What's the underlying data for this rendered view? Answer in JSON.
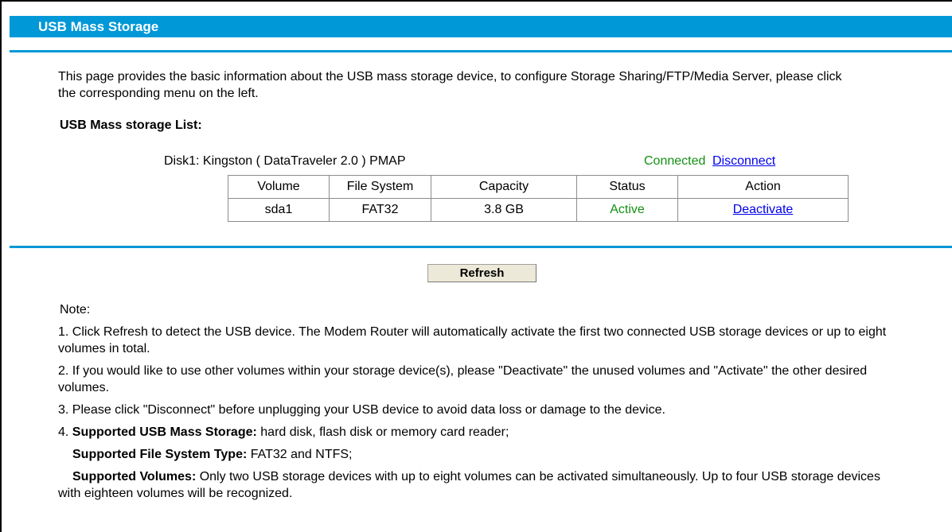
{
  "header": {
    "title": "USB Mass Storage"
  },
  "intro": {
    "text": "This page provides the basic information about the USB mass storage device, to configure Storage Sharing/FTP/Media Server, please click the corresponding menu on the left."
  },
  "storage_list": {
    "title": "USB Mass storage List:",
    "disk": {
      "label": "Disk1: Kingston ( DataTraveler 2.0 ) PMAP",
      "status": "Connected",
      "disconnect_label": "Disconnect"
    },
    "table": {
      "headers": [
        "Volume",
        "File System",
        "Capacity",
        "Status",
        "Action"
      ],
      "rows": [
        {
          "volume": "sda1",
          "file_system": "FAT32",
          "capacity": "3.8 GB",
          "status": "Active",
          "action": "Deactivate"
        }
      ]
    }
  },
  "refresh_label": "Refresh",
  "notes": {
    "label": "Note:",
    "items": [
      "1. Click Refresh to detect the USB device. The Modem Router will automatically activate the first two connected USB storage devices or up to eight volumes in total.",
      "2. If you would like to use other volumes within your storage device(s), please \"Deactivate\" the unused volumes and \"Activate\" the other desired volumes.",
      "3. Please click \"Disconnect\" before unplugging your USB device to avoid data loss or damage to the device."
    ],
    "supported": {
      "prefix": "4. ",
      "mass_storage_label": "Supported USB Mass Storage:",
      "mass_storage_value": " hard disk, flash disk or memory card reader;",
      "fs_label": "Supported File System Type:",
      "fs_value": " FAT32 and NTFS;",
      "volumes_label": "Supported Volumes:",
      "volumes_value": " Only two USB storage devices with up to eight volumes can be activated simultaneously. Up to four USB storage devices with eighteen volumes will be recognized."
    }
  },
  "colors": {
    "accent": "#0098d6",
    "status_green": "#139013",
    "link": "#0000ee"
  }
}
